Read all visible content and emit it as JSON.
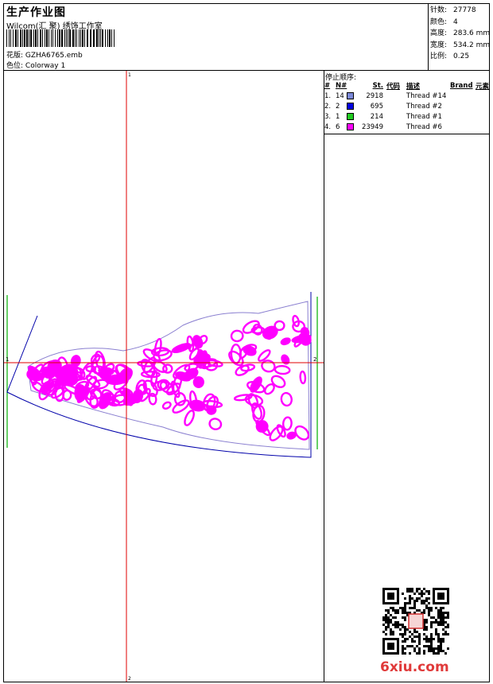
{
  "header": {
    "title": "生产作业图",
    "company": "Wilcom(汇 聚) 绣饰工作室",
    "design_label": "花版:",
    "design_value": "GZHA6765.emb",
    "colorway_label": "色位:",
    "colorway_value": "Colorway 1"
  },
  "specs": [
    {
      "label": "针数:",
      "value": "27778"
    },
    {
      "label": "颜色:",
      "value": "4"
    },
    {
      "label": "高度:",
      "value": "283.6 mm"
    },
    {
      "label": "宽度:",
      "value": "534.2 mm"
    },
    {
      "label": "比例:",
      "value": "0.25"
    }
  ],
  "stop_sequence": {
    "title": "停止顺序:",
    "headers": {
      "num": "#",
      "n": "N#",
      "st": "St.",
      "code": "代码",
      "desc": "描述",
      "brand": "Brand",
      "elem": "元素"
    },
    "rows": [
      {
        "num": "1.",
        "n": "14",
        "color": "#7b88d8",
        "st": "2918",
        "desc": "Thread #14"
      },
      {
        "num": "2.",
        "n": "2",
        "color": "#0000e0",
        "st": "695",
        "desc": "Thread #2"
      },
      {
        "num": "3.",
        "n": "1",
        "color": "#22cc22",
        "st": "214",
        "desc": "Thread #1"
      },
      {
        "num": "4.",
        "n": "6",
        "color": "#ff00ff",
        "st": "23949",
        "desc": "Thread #6"
      }
    ]
  },
  "axis_marks": {
    "left": "1",
    "right": "2",
    "top": "1",
    "bottom": "2"
  },
  "watermark": "6xiu.com",
  "colors": {
    "axis": "#e00000",
    "frame": "#0000aa",
    "guide": "#00b000",
    "fill": "#ff00ff",
    "outline": "#8a7fd0"
  }
}
